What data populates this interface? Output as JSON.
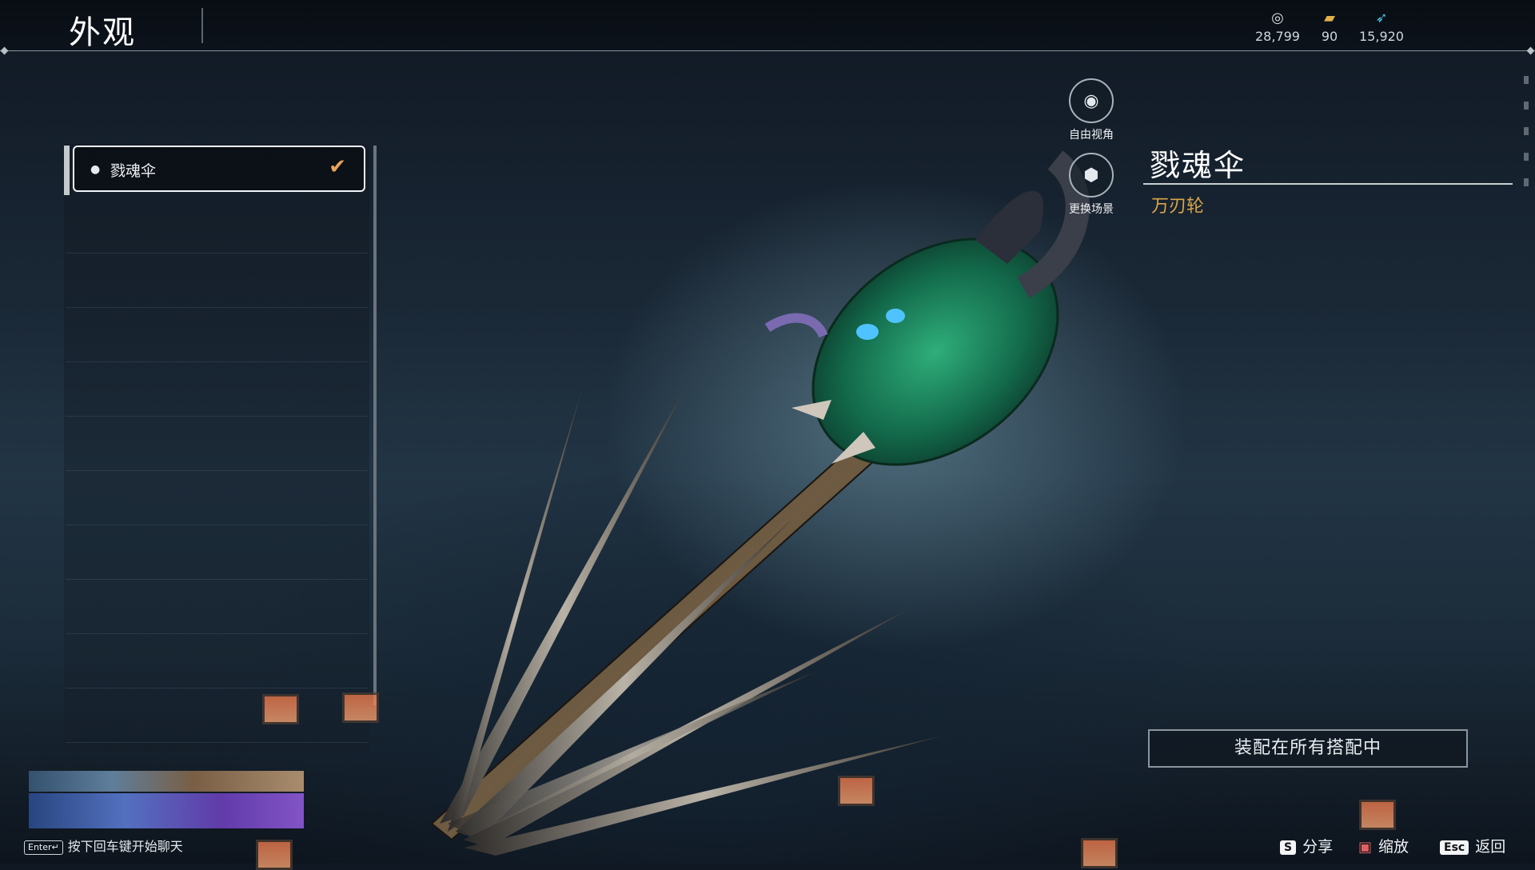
{
  "header": {
    "title": "外观",
    "currencies": [
      {
        "icon": "coin-icon",
        "value": "28,799"
      },
      {
        "icon": "ticket-icon",
        "value": "90"
      },
      {
        "icon": "feather-icon",
        "value": "15,920"
      }
    ]
  },
  "list": {
    "items": [
      {
        "label": "戮魂伞",
        "selected": true
      }
    ]
  },
  "tools": {
    "free_view_label": "自由视角",
    "change_scene_label": "更换场景"
  },
  "detail": {
    "name": "戮魂伞",
    "subtitle": "万刃轮"
  },
  "equip_button_label": "装配在所有搭配中",
  "chat": {
    "enter_key": "Enter↵",
    "hint": "按下回车键开始聊天"
  },
  "hotkeys": {
    "share": {
      "key": "S",
      "label": "分享"
    },
    "zoom": {
      "label": "缩放"
    },
    "back": {
      "key": "Esc",
      "label": "返回"
    }
  },
  "colors": {
    "accent_check": "#e8a35a",
    "subtitle_gold": "#d9a54a"
  }
}
